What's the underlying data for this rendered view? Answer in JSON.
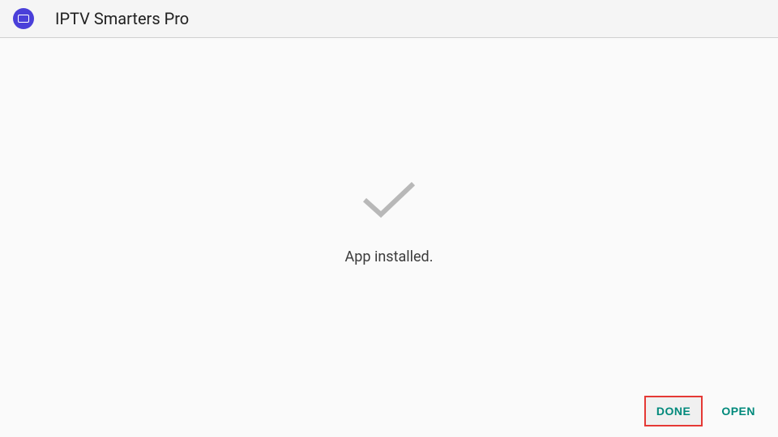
{
  "header": {
    "app_title": "IPTV Smarters Pro"
  },
  "content": {
    "status_message": "App installed."
  },
  "buttons": {
    "done_label": "DONE",
    "open_label": "OPEN"
  },
  "colors": {
    "accent": "#00897b",
    "highlight_border": "#e53935",
    "app_icon_bg": "#4a3fd9"
  }
}
